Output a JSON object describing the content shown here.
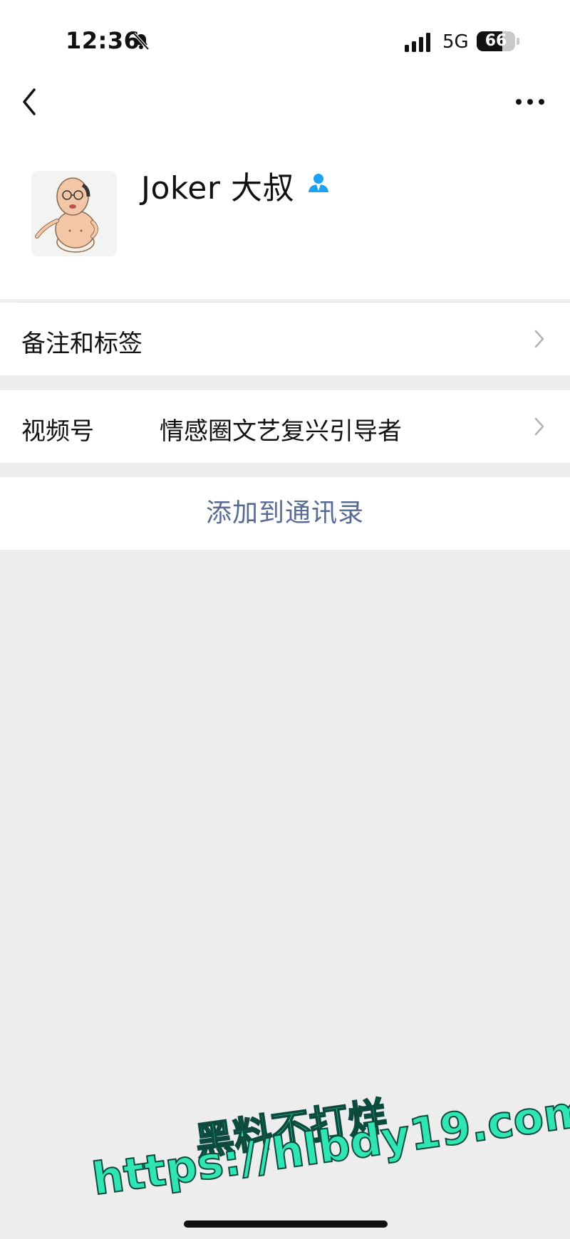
{
  "status_bar": {
    "time": "12:36",
    "network": "5G",
    "battery_level": "66",
    "battery_fraction": 0.66
  },
  "nav": {
    "back_icon": "chevron-left-icon",
    "more_icon": "more-dots-icon"
  },
  "profile": {
    "name": "Joker 大叔",
    "badge_icon": "user-verified-icon",
    "avatar": "cartoon-avatar"
  },
  "rows": {
    "remark": {
      "label": "备注和标签"
    },
    "channels": {
      "label": "视频号",
      "value": "情感圈文艺复兴引导者"
    }
  },
  "actions": {
    "add_contact": "添加到通讯录"
  },
  "watermark": {
    "line1": "黑料不打烊",
    "line2": "https://hlbdy19.com"
  },
  "colors": {
    "link": "#576b95",
    "badge": "#1da1f2",
    "watermark": "#2fe5b4",
    "background": "#ededed"
  }
}
